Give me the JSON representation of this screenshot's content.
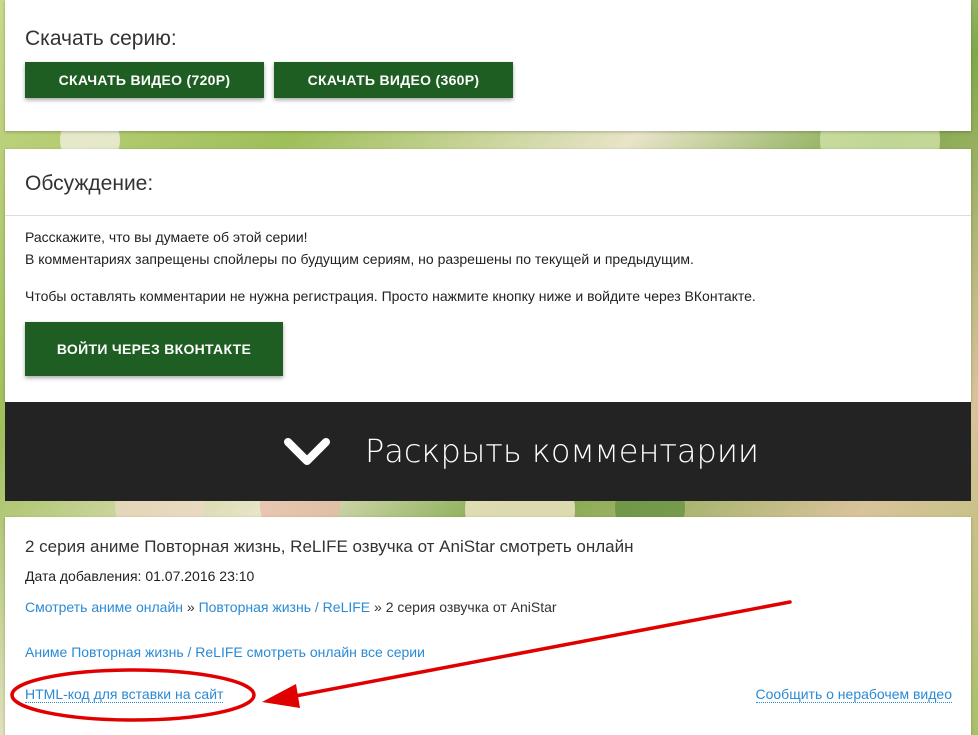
{
  "download": {
    "title": "Скачать серию:",
    "btn_720": "СКАЧАТЬ ВИДЕО (720P)",
    "btn_360": "СКАЧАТЬ ВИДЕО (360P)"
  },
  "discussion": {
    "title": "Обсуждение:",
    "line1": "Расскажите, что вы думаете об этой серии!",
    "line2": "В комментариях запрещены спойлеры по будущим сериям, но разрешены по текущей и предыдущим.",
    "line3": "Чтобы оставлять комментарии не нужна регистрация. Просто нажмите кнопку ниже и войдите через ВКонтакте.",
    "vk_button": "ВОЙТИ ЧЕРЕЗ ВКОНТАКТЕ",
    "expand_label": "Раскрыть комментарии",
    "expand_icon": "chevron-down-icon"
  },
  "episode": {
    "title": "2 серия аниме Повторная жизнь, ReLIFE озвучка от AniStar смотреть онлайн",
    "date_label": "Дата добавления:",
    "date_value": "01.07.2016 23:10",
    "breadcrumb": {
      "home": "Смотреть аниме онлайн",
      "sep1": "»",
      "series": "Повторная жизнь / ReLIFE",
      "sep2": "»",
      "current": "2 серия озвучка от AniStar"
    },
    "all_episodes": "Аниме Повторная жизнь / ReLIFE смотреть онлайн все серии",
    "html_code": "HTML-код для вставки на сайт",
    "report": "Сообщить о нерабочем видео"
  },
  "colors": {
    "button_green": "#1e5e22",
    "link_blue": "#2a8ad4",
    "expand_bar": "#232323",
    "annotation_red": "#e00000"
  }
}
